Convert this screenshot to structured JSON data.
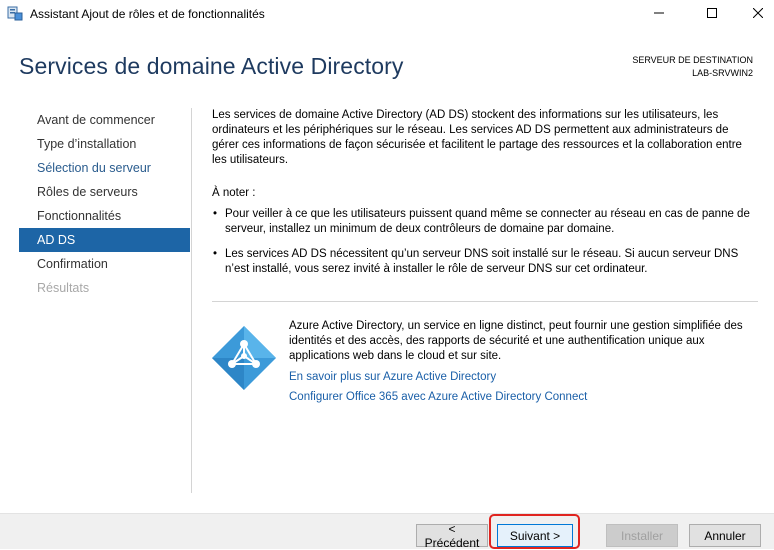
{
  "window": {
    "title": "Assistant Ajout de rôles et de fonctionnalités",
    "icons": {
      "app": "server-manager-icon",
      "minimize": "minimize-icon",
      "maximize": "maximize-icon",
      "close": "close-icon"
    }
  },
  "header": {
    "page_title": "Services de domaine Active Directory",
    "destination_label": "SERVEUR DE DESTINATION",
    "destination_server": "LAB-SRVWIN2"
  },
  "nav": {
    "items": [
      {
        "label": "Avant de commencer",
        "state": "normal"
      },
      {
        "label": "Type d’installation",
        "state": "normal"
      },
      {
        "label": "Sélection du serveur",
        "state": "link"
      },
      {
        "label": "Rôles de serveurs",
        "state": "normal"
      },
      {
        "label": "Fonctionnalités",
        "state": "normal"
      },
      {
        "label": "AD DS",
        "state": "active"
      },
      {
        "label": "Confirmation",
        "state": "normal"
      },
      {
        "label": "Résultats",
        "state": "disabled"
      }
    ]
  },
  "content": {
    "intro": "Les services de domaine Active Directory (AD DS) stockent des informations sur les utilisateurs, les ordinateurs et les périphériques sur le réseau. Les services AD DS permettent aux administrateurs de gérer ces informations de façon sécurisée et facilitent le partage des ressources et la collaboration entre les utilisateurs.",
    "note_title": "À noter :",
    "bullets": [
      "Pour veiller à ce que les utilisateurs puissent quand même se connecter au réseau en cas de panne de serveur, installez un minimum de deux contrôleurs de domaine par domaine.",
      "Les services AD DS nécessitent qu’un serveur DNS soit installé sur le réseau. Si aucun serveur DNS n’est installé, vous serez invité à installer le rôle de serveur DNS sur cet ordinateur."
    ],
    "bullet_char": "•",
    "azure": {
      "icon": "azure-ad-icon",
      "text": "Azure Active Directory, un service en ligne distinct, peut fournir une gestion simplifiée des identités et des accès, des rapports de sécurité et une authentification unique aux applications web dans le cloud et sur site.",
      "link1": "En savoir plus sur Azure Active Directory",
      "link2": "Configurer Office 365 avec Azure Active Directory Connect"
    }
  },
  "footer": {
    "prev": "< Précédent",
    "next": "Suivant >",
    "install": "Installer",
    "cancel": "Annuler"
  },
  "colors": {
    "accent": "#1d65a6",
    "link": "#1a5fa8",
    "highlight": "#e0241f"
  }
}
